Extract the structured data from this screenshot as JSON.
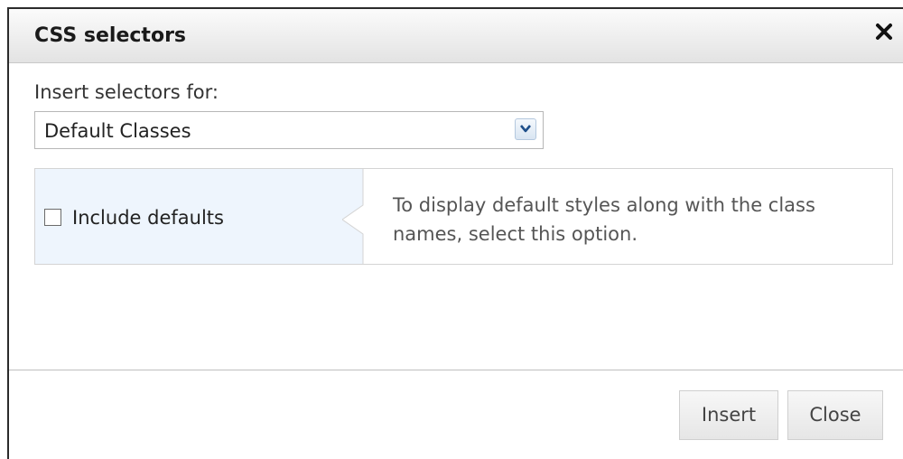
{
  "dialog": {
    "title": "CSS selectors",
    "close_icon": "close-x-icon"
  },
  "form": {
    "selector_label": "Insert selectors for:",
    "selector_value": "Default Classes",
    "dropdown_icon": "chevron-down-icon"
  },
  "option": {
    "checkbox_label": "Include defaults",
    "checked": false,
    "help_text": "To display default styles along with the class names, select this option."
  },
  "buttons": {
    "insert_label": "Insert",
    "close_label": "Close"
  },
  "colors": {
    "title_bar": "#e3e3e3",
    "option_highlight": "#eef5fd",
    "help_text": "#555555"
  }
}
